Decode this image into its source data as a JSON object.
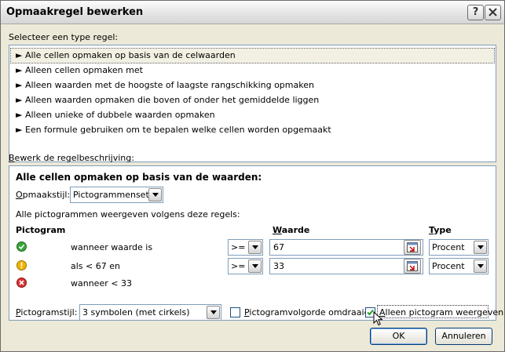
{
  "window": {
    "title": "Opmaakregel bewerken"
  },
  "rule_type": {
    "label": "Selecteer een type regel:",
    "items": [
      "► Alle cellen opmaken op basis van de celwaarden",
      "► Alleen cellen opmaken met",
      "► Alleen waarden met de hoogste of laagste rangschikking opmaken",
      "► Alleen waarden opmaken die boven of onder het gemiddelde liggen",
      "► Alleen unieke of dubbele waarden opmaken",
      "► Een formule gebruiken om te bepalen welke cellen worden opgemaakt"
    ],
    "selected_index": 0
  },
  "description": {
    "label_prefix": "B",
    "label_rest": "ewerk de regelbeschrijving:",
    "title": "Alle cellen opmaken op basis van de waarden:",
    "style_label_prefix": "O",
    "style_label_rest": "pmaakstijl:",
    "style_value": "Pictogrammensets",
    "rules_intro": "Alle pictogrammen weergeven volgens deze regels:",
    "col_icon": "Pictogram",
    "col_value_prefix": "W",
    "col_value_rest": "aarde",
    "col_type_prefix": "T",
    "col_type_rest": "ype",
    "rows": [
      {
        "icon": "green-circle-check-icon",
        "condition": "wanneer waarde is",
        "operator": ">=",
        "value": "67",
        "type": "Procent"
      },
      {
        "icon": "yellow-circle-exclamation-icon",
        "condition": "als < 67 en",
        "operator": ">=",
        "value": "33",
        "type": "Procent"
      },
      {
        "icon": "red-circle-x-icon",
        "condition": "wanneer < 33"
      }
    ],
    "icon_style_label_prefix": "P",
    "icon_style_label_rest": "ictogramstijl:",
    "icon_style_value": "3 symbolen (met cirkels)",
    "reverse_label_prefix": "P",
    "reverse_label_rest": "ictogramvolgorde omdraaien",
    "reverse_checked": false,
    "icon_only_label_prefix": "A",
    "icon_only_label_rest": "lleen pictogram weergeven",
    "icon_only_checked": true
  },
  "buttons": {
    "ok": "OK",
    "cancel": "Annuleren"
  },
  "colors": {
    "green": "#3aa43a",
    "yellow": "#f0b400",
    "red": "#d83232",
    "border": "#7f9db9"
  }
}
